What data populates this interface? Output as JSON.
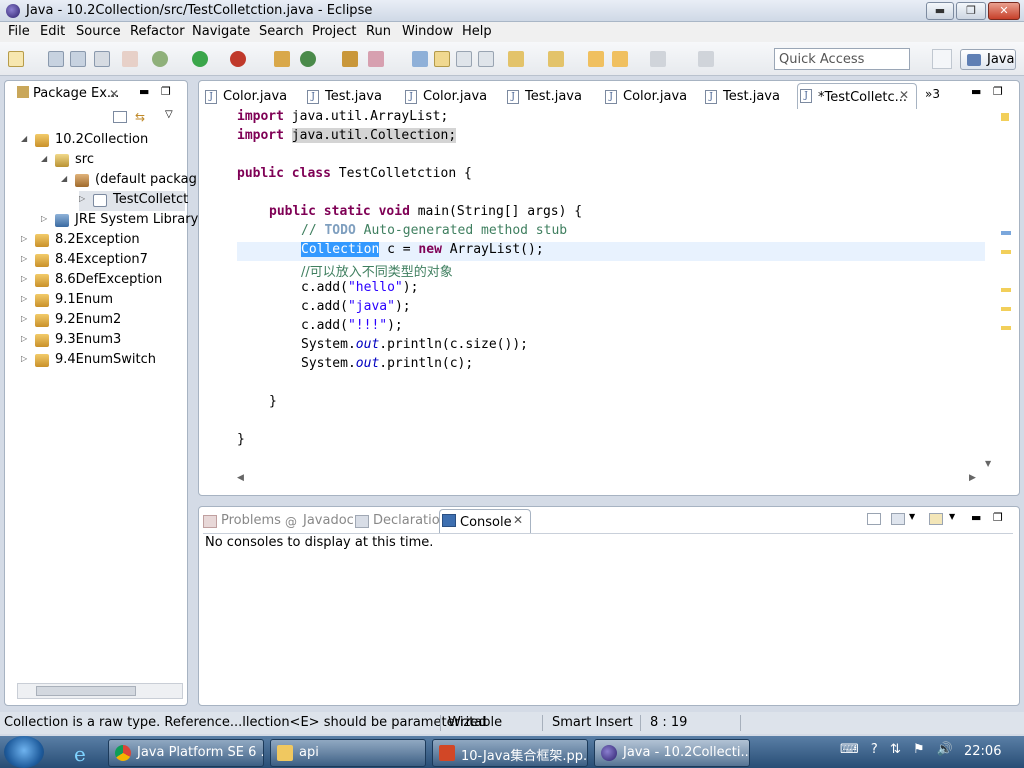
{
  "window": {
    "title": "Java - 10.2Collection/src/TestColletction.java - Eclipse",
    "minimize": "▬",
    "maximize": "❐",
    "close": "✕"
  },
  "menu": [
    "File",
    "Edit",
    "Source",
    "Refactor",
    "Navigate",
    "Search",
    "Project",
    "Run",
    "Window",
    "Help"
  ],
  "toolbar": {
    "quick_access": "Quick Access",
    "perspective": "Java"
  },
  "package_explorer": {
    "tab_label": "Package Ex...",
    "tree": [
      {
        "label": "10.2Collection",
        "arrow": "◢",
        "icon": "project"
      },
      {
        "label": "src",
        "arrow": "◢",
        "icon": "src"
      },
      {
        "label": "(default packag",
        "arrow": "◢",
        "icon": "package"
      },
      {
        "label": "TestColletct",
        "arrow": "▷",
        "icon": "file"
      },
      {
        "label": "JRE System Library",
        "arrow": "▷",
        "icon": "library"
      },
      {
        "label": "8.2Exception",
        "arrow": "▷",
        "icon": "project"
      },
      {
        "label": "8.4Exception7",
        "arrow": "▷",
        "icon": "project"
      },
      {
        "label": "8.6DefException",
        "arrow": "▷",
        "icon": "project"
      },
      {
        "label": "9.1Enum",
        "arrow": "▷",
        "icon": "project"
      },
      {
        "label": "9.2Enum2",
        "arrow": "▷",
        "icon": "project"
      },
      {
        "label": "9.3Enum3",
        "arrow": "▷",
        "icon": "project"
      },
      {
        "label": "9.4EnumSwitch",
        "arrow": "▷",
        "icon": "project"
      }
    ]
  },
  "editor": {
    "tabs": [
      "Color.java",
      "Test.java",
      "Color.java",
      "Test.java",
      "Color.java",
      "Test.java",
      "*TestColletc..."
    ],
    "overflow": "»3",
    "code": {
      "import_kw": "import",
      "import1": "java.util.ArrayList;",
      "import2": "java.util.Collection",
      "semicolon": ";",
      "public_kw": "public",
      "class_kw": "class",
      "class_name": "TestColletction {",
      "static_kw": "static",
      "void_kw": "void",
      "main_sig": "main(String[] args) {",
      "comment_prefix": "// ",
      "todo": "TODO",
      "comment_rest": " Auto-generated method stub",
      "collection_sel": "Collection",
      "c_eq": " c = ",
      "new_kw": "new",
      "arraylist": " ArrayList();",
      "cn_comment": "//可以放入不同类型的对象",
      "add_prefix": "c.add(",
      "str_hello": "\"hello\"",
      "str_java": "\"java\"",
      "str_excl": "\"!!!\"",
      "paren_end": ");",
      "sys": "System.",
      "out": "out",
      "println_size": ".println(c.size());",
      "println_c": ".println(c);",
      "brace": "}"
    }
  },
  "console": {
    "tabs": [
      "Problems",
      "Javadoc",
      "Declaration",
      "Console"
    ],
    "message": "No consoles to display at this time."
  },
  "status": {
    "message": "Collection is a raw type. Reference...llection<E> should be parameterized",
    "writable": "Writable",
    "insert_mode": "Smart Insert",
    "position": "8 : 19"
  },
  "taskbar": {
    "tasks": [
      "Java Platform SE 6 ...",
      "api",
      "10-Java集合框架.pp...",
      "Java - 10.2Collecti..."
    ],
    "clock": "22:06"
  },
  "colors": {
    "keyword": "#7f0055",
    "comment": "#3f7f5f",
    "string": "#2a00ff",
    "selection": "#3399ff"
  }
}
